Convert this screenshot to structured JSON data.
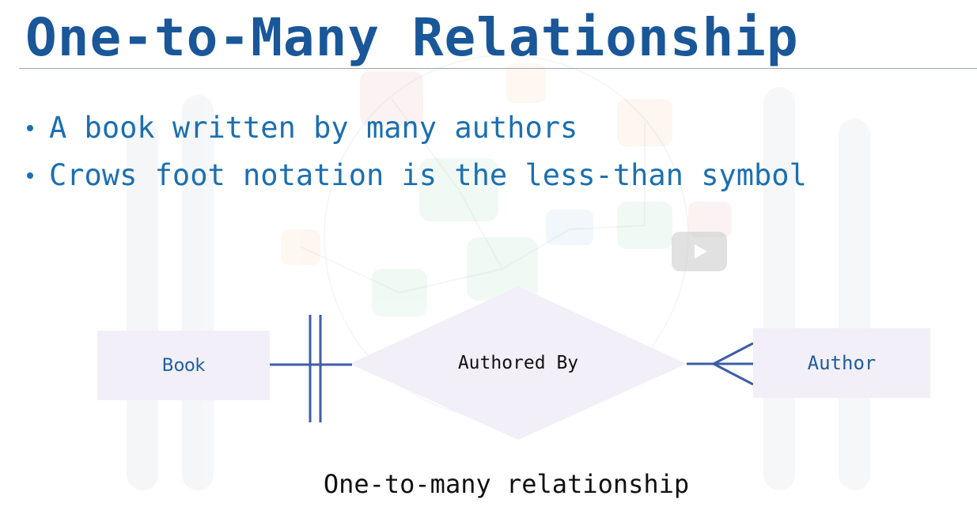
{
  "slide": {
    "title": "One-to-Many Relationship",
    "bullets": [
      "A book written by many authors",
      "Crows foot notation is the less-than symbol"
    ]
  },
  "diagram": {
    "entity_left": "Book",
    "relationship": "Authored By",
    "entity_right": "Author",
    "caption": "One-to-many relationship"
  },
  "icons": {
    "play": "play-icon"
  },
  "colors": {
    "title": "#1a5799",
    "bullet_text": "#1c6fb0",
    "entity_fill": "#f2eff9",
    "line": "#3d5ea6"
  }
}
